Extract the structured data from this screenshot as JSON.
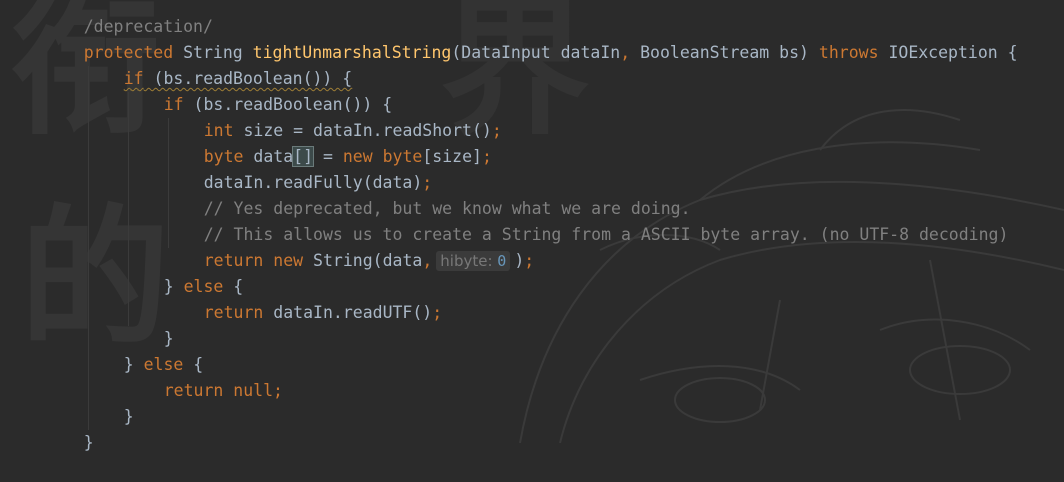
{
  "lines": {
    "l0": {
      "text": "/deprecation/"
    },
    "l1": {
      "t1": "protected",
      "t2": " String ",
      "t3": "tightUnmarshalString",
      "t4": "(DataInput dataIn",
      "t5": ",",
      "t6": " BooleanStream bs) ",
      "t7": "throws",
      "t8": " IOException {"
    },
    "l2": {
      "t1": "if",
      "t2": " (bs.readBoolean()) {"
    },
    "l3": {
      "t1": "if",
      "t2": " (bs.readBoolean()) {"
    },
    "l4": {
      "t1": "int",
      "t2": " size = dataIn.readShort()",
      "t3": ";"
    },
    "l5": {
      "t1": "byte",
      "t2": " data",
      "t3": "[]",
      "t4": " = ",
      "t5": "new",
      "t6": " ",
      "t7": "byte",
      "t8": "[size]",
      "t9": ";"
    },
    "l6": {
      "t1": "dataIn.readFully(data)",
      "t2": ";"
    },
    "l7": {
      "t1": "// Yes deprecated, but we know what we are doing."
    },
    "l8": {
      "t1": "// This allows us to create a String from a ASCII byte array. (no UTF-8 decoding)"
    },
    "l9": {
      "t1": "return",
      "t2": " ",
      "t3": "new",
      "t4": " String(data",
      "t5": ",",
      "hint_label": "hibyte:",
      "hint_value": "0",
      "t6": ")",
      "t7": ";"
    },
    "l10": {
      "t1": "} ",
      "t2": "else",
      "t3": " {"
    },
    "l11": {
      "t1": "return",
      "t2": " dataIn.readUTF()",
      "t3": ";"
    },
    "l12": {
      "t1": "}"
    },
    "l13": {
      "t1": "} ",
      "t2": "else",
      "t3": " {"
    },
    "l14": {
      "t1": "return",
      "t2": " ",
      "t3": "null",
      "t4": ";"
    },
    "l15": {
      "t1": "}"
    },
    "l16": {
      "t1": "}"
    }
  },
  "colors": {
    "background": "#2b2b2b",
    "keyword": "#cc7832",
    "method": "#ffc66d",
    "comment": "#808080",
    "number": "#6897bb",
    "text": "#a9b7c6"
  },
  "watermark": {
    "char1": "衔",
    "char2": "界",
    "char3": "的"
  }
}
